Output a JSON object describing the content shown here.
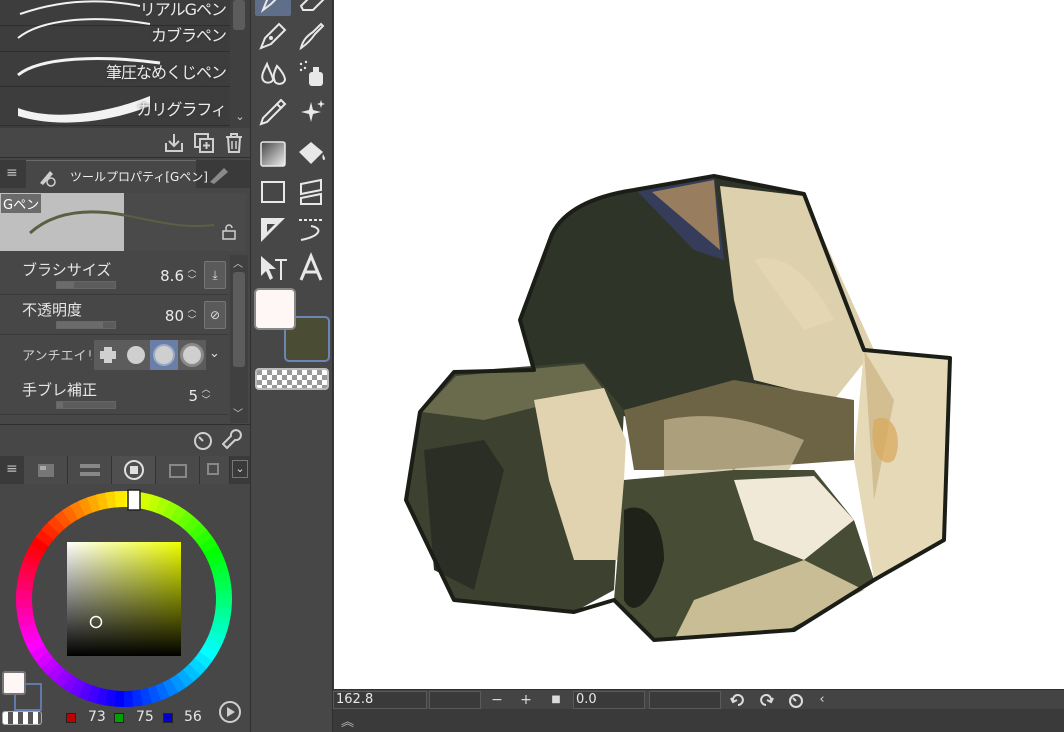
{
  "brush_list": {
    "items": [
      {
        "label": "リアルGペン",
        "stroke": "thin"
      },
      {
        "label": "カブラペン",
        "stroke": "thin"
      },
      {
        "label": "筆圧なめくじペン",
        "stroke": "medium"
      },
      {
        "label": "カリグラフィ",
        "stroke": "thick"
      }
    ]
  },
  "tool_property": {
    "tab_title": "ツールプロパティ[Gペン]",
    "preview_label": "Gペン",
    "brush_size": {
      "label": "ブラシサイズ",
      "value": "8.6",
      "level": 0.3
    },
    "opacity": {
      "label": "不透明度",
      "value": "80",
      "level": 0.8
    },
    "antialiasing": {
      "label": "アンチエイリアス",
      "selected_index": 2
    },
    "stabilization": {
      "label": "手ブレ補正",
      "value": "5",
      "level": 0.1
    }
  },
  "color": {
    "main": "#fff7f5",
    "sub": "#4a4d34",
    "hue": "#eeff00",
    "r": "73",
    "g": "75",
    "b": "56",
    "r_swatch": "#c00000",
    "g_swatch": "#00a000",
    "b_swatch": "#0000c8"
  },
  "toolbar": {
    "tools": [
      "pen-icon",
      "eraser-icon",
      "pencil-icon",
      "brush-icon",
      "blend-drops-icon",
      "airbrush-icon",
      "eyedropper-icon",
      "sparkle-icon",
      "gradient-icon",
      "fill-bucket-icon",
      "rectangle-icon",
      "frame-icon",
      "ruler-icon",
      "curve-ruler-icon",
      "operation-icon",
      "text-icon"
    ],
    "active_tool": "pen-icon"
  },
  "status": {
    "zoom": "162.8",
    "angle": "0.0",
    "zoom_out": "−",
    "zoom_in": "+",
    "fit": "■",
    "collapse": "‹",
    "expand": "︽"
  }
}
